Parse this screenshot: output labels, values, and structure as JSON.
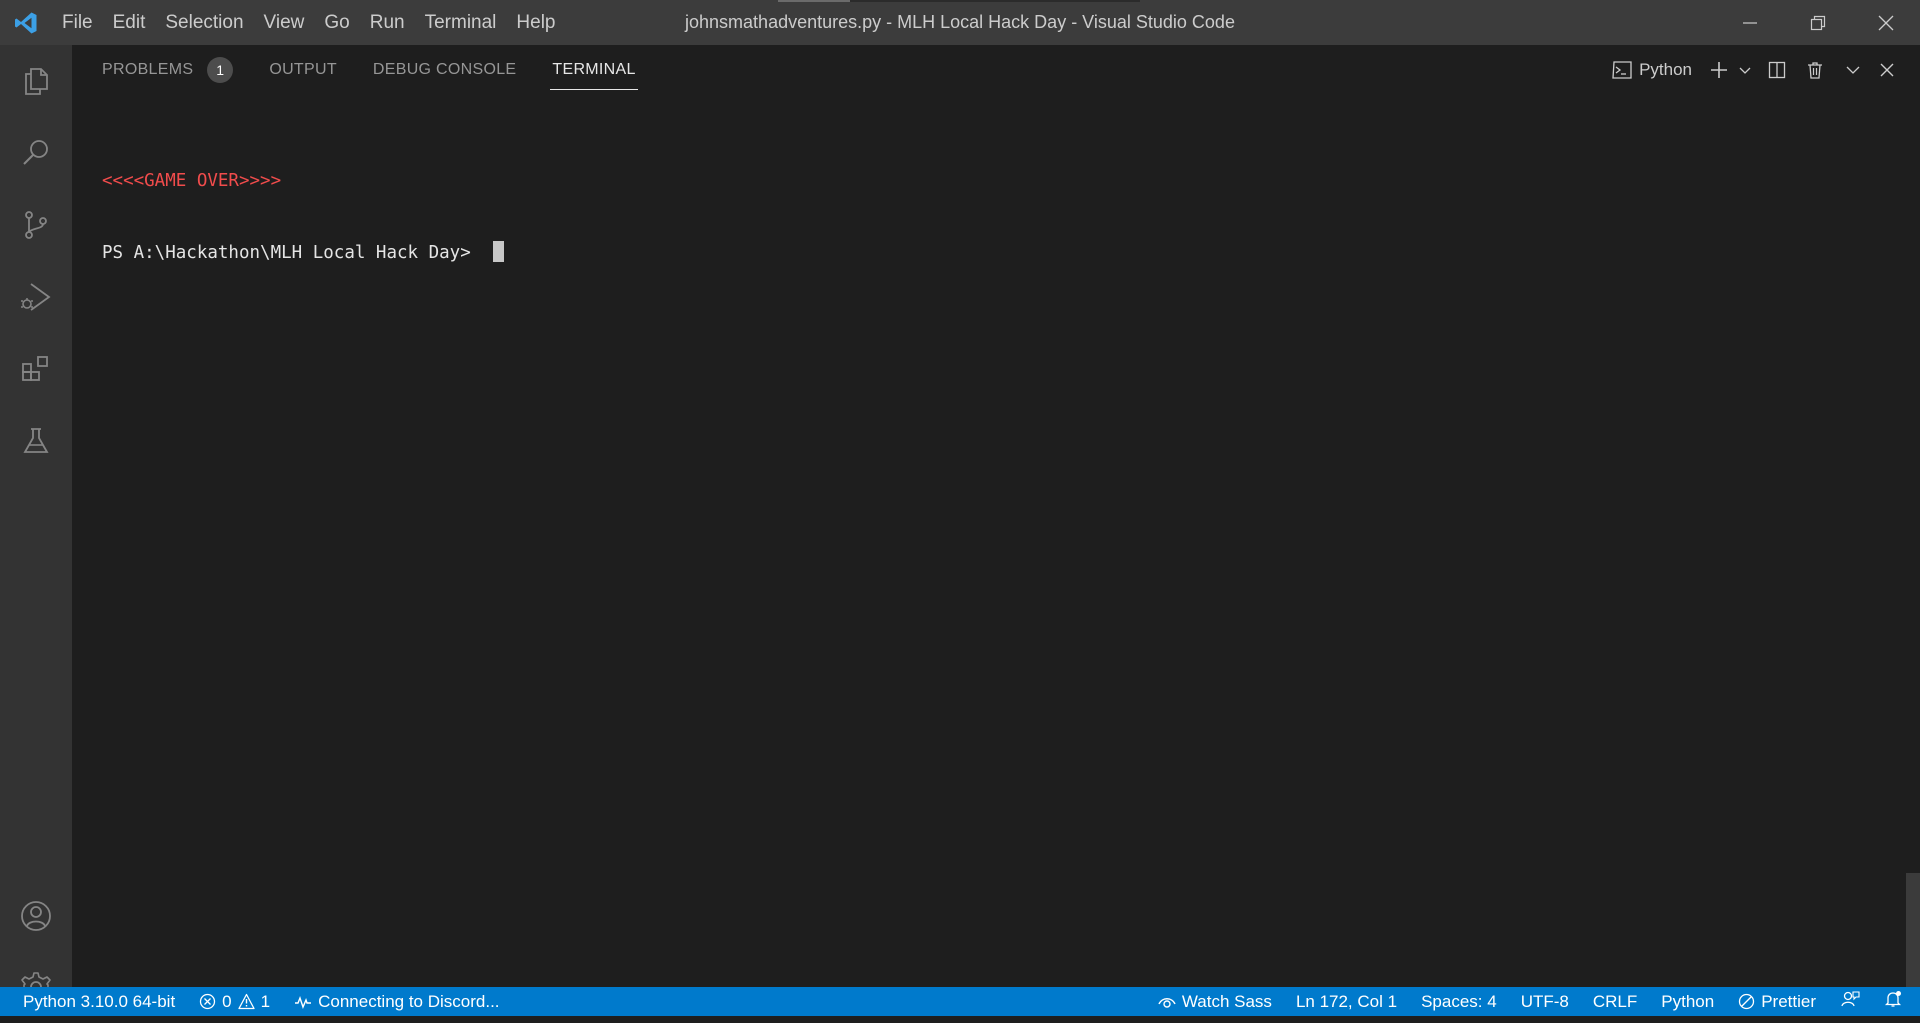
{
  "menu": [
    "File",
    "Edit",
    "Selection",
    "View",
    "Go",
    "Run",
    "Terminal",
    "Help"
  ],
  "window_title": "johnsmathadventures.py - MLH Local Hack Day - Visual Studio Code",
  "panel": {
    "tabs": {
      "problems": "PROBLEMS",
      "problems_count": "1",
      "output": "OUTPUT",
      "debug_console": "DEBUG CONSOLE",
      "terminal": "TERMINAL"
    },
    "shell_name": "Python"
  },
  "terminal": {
    "line1": "<<<<GAME OVER>>>>",
    "line2": "PS A:\\Hackathon\\MLH Local Hack Day> "
  },
  "status": {
    "interpreter": "Python 3.10.0 64-bit",
    "errors": "0",
    "warnings": "1",
    "discord": "Connecting to Discord...",
    "watch_sass": "Watch Sass",
    "position": "Ln 172, Col 1",
    "spaces": "Spaces: 4",
    "encoding": "UTF-8",
    "eol": "CRLF",
    "language": "Python",
    "prettier": "Prettier"
  },
  "colors": {
    "accent": "#007acc",
    "error_text": "#f14c4c",
    "vscode_logo": "#3ca0e6"
  }
}
